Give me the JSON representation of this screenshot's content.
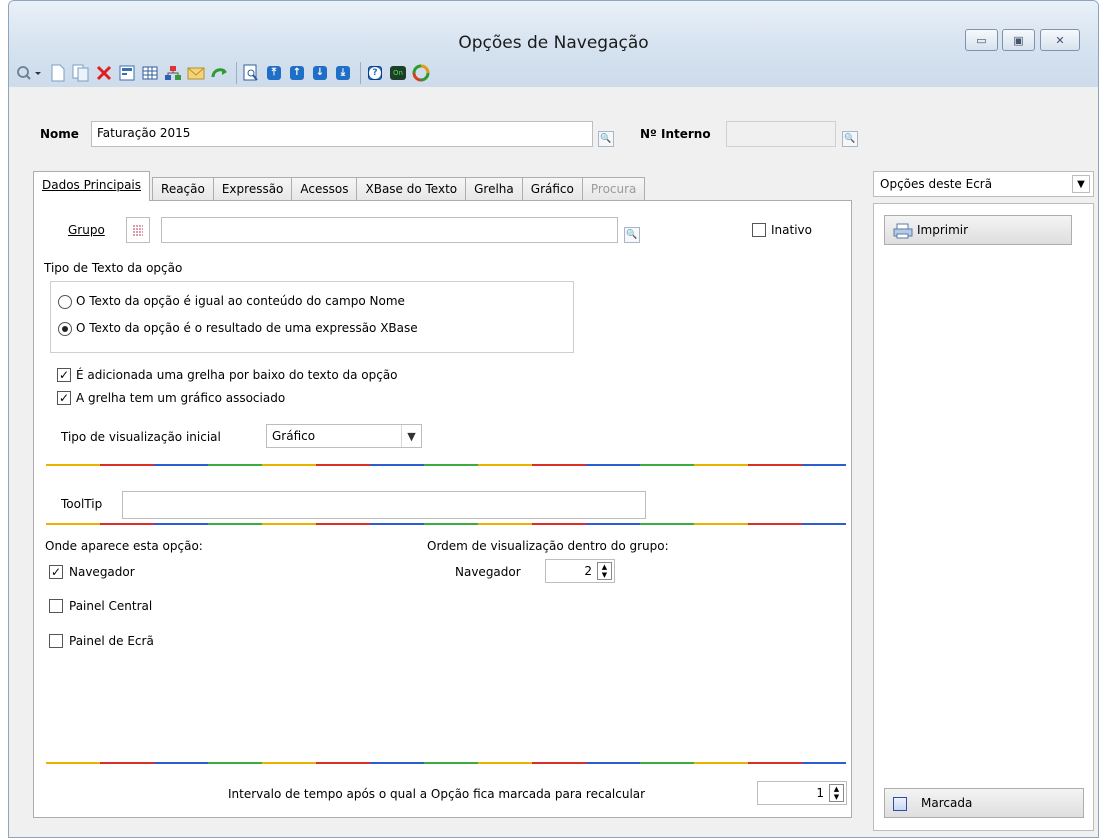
{
  "window": {
    "title": "Opções de Navegação",
    "controls": {
      "minimize": "▭",
      "maximize": "▣",
      "close": "✕"
    }
  },
  "toolbar": {
    "icons": [
      "search-dropdown",
      "new-document",
      "copy-document",
      "delete",
      "properties",
      "grid",
      "hierarchy",
      "mail",
      "refresh",
      "preview",
      "move-top",
      "move-up",
      "move-down",
      "move-bottom",
      "help",
      "console",
      "recycle"
    ]
  },
  "header": {
    "nome_label": "Nome",
    "nome_value": "Faturação 2015",
    "interno_label": "Nº Interno",
    "interno_value": ""
  },
  "tabs": [
    "Dados Principais",
    "Reação",
    "Expressão",
    "Acessos",
    "XBase do Texto",
    "Grelha",
    "Gráfico",
    "Procura"
  ],
  "main": {
    "grupo_label": "Grupo",
    "grupo_value": "",
    "inativo_label": "Inativo",
    "inativo_checked": false,
    "tipo_texto_label": "Tipo de Texto da opção",
    "radio1": "O Texto da opção é igual ao conteúdo do campo Nome",
    "radio2": "O Texto da opção é o resultado de uma expressão XBase",
    "selected_radio": 2,
    "chk_grelha": "É adicionada uma grelha por baixo do texto da opção",
    "chk_grafico": "A grelha tem um gráfico associado",
    "tipo_visualizacao_label": "Tipo de visualização inicial",
    "tipo_visualizacao_value": "Gráfico",
    "tooltip_label": "ToolTip",
    "tooltip_value": "",
    "onde_label": "Onde aparece esta opção:",
    "navegador_label": "Navegador",
    "navegador_checked": true,
    "painel_central_label": "Painel Central",
    "painel_ecra_label": "Painel de Ecrã",
    "ordem_label": "Ordem de visualização dentro do grupo:",
    "ordem_navegador_label": "Navegador",
    "ordem_navegador_value": "2",
    "intervalo_label": "Intervalo de tempo após o qual a Opção fica marcada para recalcular",
    "intervalo_value": "1"
  },
  "side": {
    "combo_value": "Opções deste Ecrã",
    "imprimir": "Imprimir",
    "marcada": "Marcada"
  },
  "colors": {
    "rainbow": [
      "#e8b400",
      "#d9302a",
      "#2b5fd1",
      "#3eaa43"
    ]
  }
}
